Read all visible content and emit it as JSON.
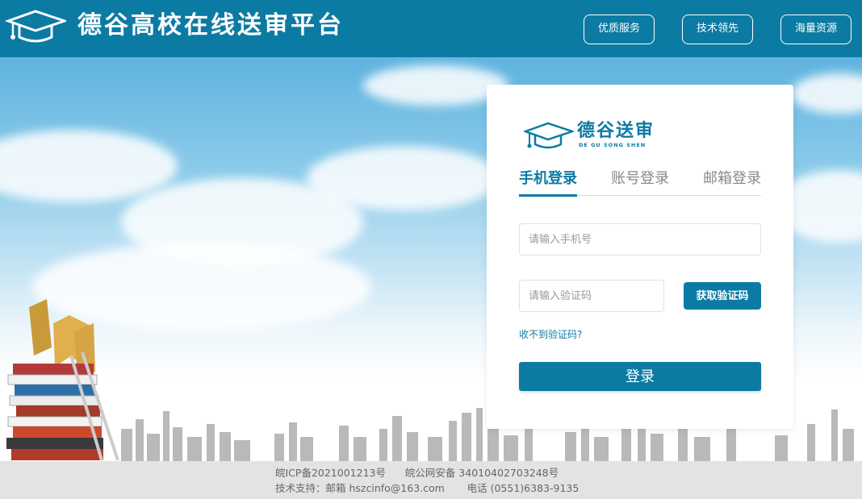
{
  "header": {
    "title": "德谷高校在线送审平台",
    "nav": [
      "优质服务",
      "技术领先",
      "海量资源"
    ]
  },
  "card": {
    "brand": "德谷送审",
    "brand_sub": "DE GU SONG SHEN",
    "tabs": [
      "手机登录",
      "账号登录",
      "邮箱登录"
    ],
    "active_tab": "手机登录",
    "phone_placeholder": "请输入手机号",
    "code_placeholder": "请输入验证码",
    "get_code_label": "获取验证码",
    "no_code_link": "收不到验证码?",
    "login_label": "登录"
  },
  "footer": {
    "line1": "皖ICP备2021001213号      皖公网安备 34010402703248号",
    "line2": "技术支持：邮箱 hszcinfo@163.com       电话 (0551)6383-9135"
  },
  "colors": {
    "brand": "#0b7ba3",
    "footer_bg": "#e3e3e3"
  },
  "icons": [
    "graduation-cap-icon"
  ]
}
